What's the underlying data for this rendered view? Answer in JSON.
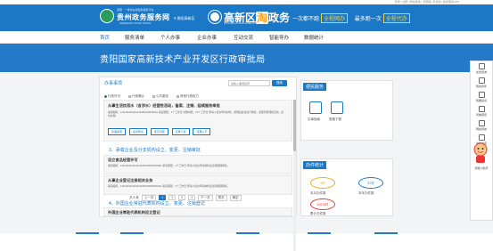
{
  "topbar": {
    "text": "登录 | 注册 | 网站导航 | 无障碍 | 手机版 | 政务服务APP"
  },
  "header": {
    "logo_top": "贵阳 · 一体化在线政务服务平台",
    "logo_main": "贵州政务服务网",
    "logo_sub": "ZHENGWU FUWU WANG",
    "area": "贵阳高新区",
    "logo2_pre": "高新区",
    "logo2_hl": "淘",
    "logo2_post": "政务",
    "logo2_sub": "GUIYANG HI-TECH ZONE GOVERNMENT",
    "slogan_a": "一次都不跑",
    "slogan_a_box": "全程网办",
    "slogan_b": "最多跑一次",
    "slogan_b_box": "全程代办"
  },
  "nav": {
    "items": [
      "首页",
      "服务清单",
      "个人办事",
      "企业办事",
      "互动交流",
      "智能导办",
      "数据统计"
    ],
    "active_index": 0
  },
  "hero": {
    "title": "贵阳国家高新技术产业开发区行政审批局"
  },
  "left_panel": {
    "title": "办事事项",
    "search_placeholder": "请输入事项名称",
    "search_button": "搜索",
    "filters": [
      "行政许可",
      "行政确认",
      "公共服务",
      "其他行政权力"
    ],
    "items": [
      {
        "title": "从事生活饮用水（含涉水）经营性活动，备案、注销、延续服务审批",
        "desc": "事项编码：11111111111111114452199000001 承诺期限：1个工作日 办理时限：20个工作日 申请人提交申请材料，受理后依法进行审核，需要到现场核实的，按时办理。",
        "buttons": [
          "办事指南",
          "在线申请",
          "常见问题",
          "表单下载",
          "结果公示"
        ]
      }
    ],
    "cat3": "3、承载企业及分支机构设立、变更、注销审批",
    "item2_title": "设立食品经营许可",
    "item2_desc": "事项编码：11111111111111114452199000001301 承诺期限：1个工作日 申请人提交申请材料后当场受理审核。",
    "item3_title": "从事企业登记注册相关业务",
    "item3_desc": "事项编码：11111111111111114452199000001401 承诺期限：1个工作日 申请人提交申请材料后当场受理审核。",
    "cat4": "4、外国企业常驻代表机构设立、变更、注销登记",
    "item4_title": "外国企业常驻代表机构设立登记",
    "pager": {
      "total": "共 8 条",
      "prev": "上一页",
      "pages": [
        "1",
        "2",
        "3",
        "4"
      ],
      "next": "下一页",
      "last": "尾页",
      "goto": "确定"
    }
  },
  "right_panel1": {
    "title": "便民服务",
    "items": [
      "办事指南",
      "表格下载"
    ]
  },
  "right_panel2": {
    "title": "办件统计",
    "stats": [
      {
        "value": "4件",
        "label": "本月办件数",
        "color": "#f5a623"
      },
      {
        "value": "37件",
        "label": "本年办件数",
        "color": "#1b78c7"
      },
      {
        "value": "32578件",
        "label": "累计办件数",
        "color": "#e33b3b"
      }
    ]
  },
  "sidebar": {
    "items": [
      "在线咨询",
      "我的办件",
      "我要投诉",
      "问卷调查",
      "网站导航",
      "办件进度"
    ],
    "mascot_label": "智能小助手"
  }
}
